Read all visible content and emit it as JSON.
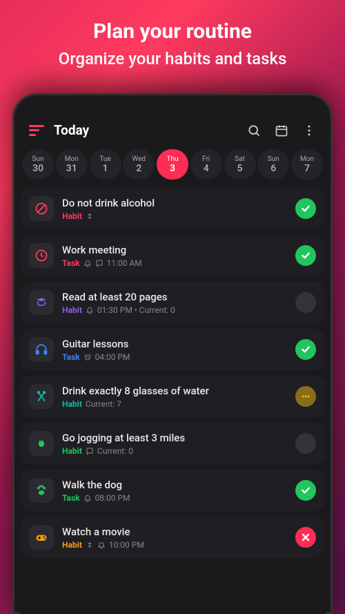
{
  "promo": {
    "title": "Plan your routine",
    "subtitle": "Organize your habits and tasks"
  },
  "header": {
    "title": "Today"
  },
  "dates": [
    {
      "dow": "Sun",
      "num": "30",
      "selected": false
    },
    {
      "dow": "Mon",
      "num": "31",
      "selected": false
    },
    {
      "dow": "Tue",
      "num": "1",
      "selected": false
    },
    {
      "dow": "Wed",
      "num": "2",
      "selected": false
    },
    {
      "dow": "Thu",
      "num": "3",
      "selected": true
    },
    {
      "dow": "Fri",
      "num": "4",
      "selected": false
    },
    {
      "dow": "Sat",
      "num": "5",
      "selected": false
    },
    {
      "dow": "Sun",
      "num": "6",
      "selected": false
    },
    {
      "dow": "Mon",
      "num": "7",
      "selected": false
    }
  ],
  "items": [
    {
      "icon": "forbidden-icon",
      "iconColor": "#ff3a5e",
      "title": "Do not drink alcohol",
      "type": "Habit",
      "typeClass": "type-habit-red",
      "meta": "",
      "metaIcons": [
        "priority-icon"
      ],
      "status": "check"
    },
    {
      "icon": "clock-icon",
      "iconColor": "#ff3a5e",
      "title": "Work meeting",
      "type": "Task",
      "typeClass": "type-task-red",
      "meta": "11:00 AM",
      "metaIcons": [
        "bell-icon",
        "note-icon"
      ],
      "status": "check"
    },
    {
      "icon": "book-icon",
      "iconColor": "#8b5cf6",
      "title": "Read at least 20 pages",
      "type": "Habit",
      "typeClass": "type-habit-purple",
      "meta": "01:30 PM • Current: 0",
      "metaIcons": [
        "bell-icon"
      ],
      "status": "empty"
    },
    {
      "icon": "headphones-icon",
      "iconColor": "#3b82f6",
      "title": "Guitar lessons",
      "type": "Task",
      "typeClass": "type-task-blue",
      "meta": "04:00 PM",
      "metaIcons": [
        "alarm-icon"
      ],
      "status": "check"
    },
    {
      "icon": "cutlery-icon",
      "iconColor": "#14b8a6",
      "title": "Drink exactly 8 glasses of water",
      "type": "Habit",
      "typeClass": "type-habit-teal",
      "meta": "Current: 7",
      "metaIcons": [],
      "status": "dots"
    },
    {
      "icon": "flame-icon",
      "iconColor": "#22c55e",
      "title": "Go jogging at least 3 miles",
      "type": "Habit",
      "typeClass": "type-habit-green",
      "meta": "Current: 0",
      "metaIcons": [
        "note-icon"
      ],
      "status": "empty"
    },
    {
      "icon": "paw-icon",
      "iconColor": "#22c55e",
      "title": "Walk the dog",
      "type": "Task",
      "typeClass": "type-task-green",
      "meta": "08:00 PM",
      "metaIcons": [
        "bell-icon"
      ],
      "status": "check"
    },
    {
      "icon": "gamepad-icon",
      "iconColor": "#f59e0b",
      "title": "Watch a movie",
      "type": "Habit",
      "typeClass": "type-habit-amber",
      "meta": "10:00 PM",
      "metaIcons": [
        "priority-down-icon",
        "bell-icon"
      ],
      "status": "cross"
    }
  ]
}
